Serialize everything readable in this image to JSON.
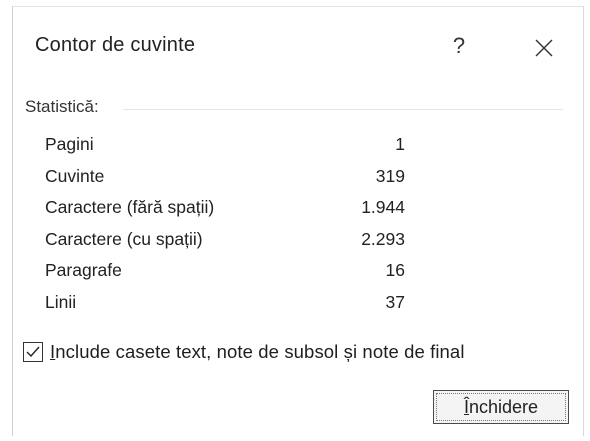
{
  "dialog": {
    "title": "Contor de cuvinte",
    "help_label": "?",
    "close_icon": "close-icon"
  },
  "stats": {
    "section_label": "Statistică:",
    "rows": [
      {
        "label": "Pagini",
        "value": "1"
      },
      {
        "label": "Cuvinte",
        "value": "319"
      },
      {
        "label": "Caractere (fără spații)",
        "value": "1.944"
      },
      {
        "label": "Caractere (cu spații)",
        "value": "2.293"
      },
      {
        "label": "Paragrafe",
        "value": "16"
      },
      {
        "label": "Linii",
        "value": "37"
      }
    ]
  },
  "options": {
    "include_checkbox_checked": true,
    "include_label_first": "I",
    "include_label_rest": "nclude casete text, note de subsol și note de final"
  },
  "buttons": {
    "close_first": "Î",
    "close_rest": "nchidere"
  }
}
